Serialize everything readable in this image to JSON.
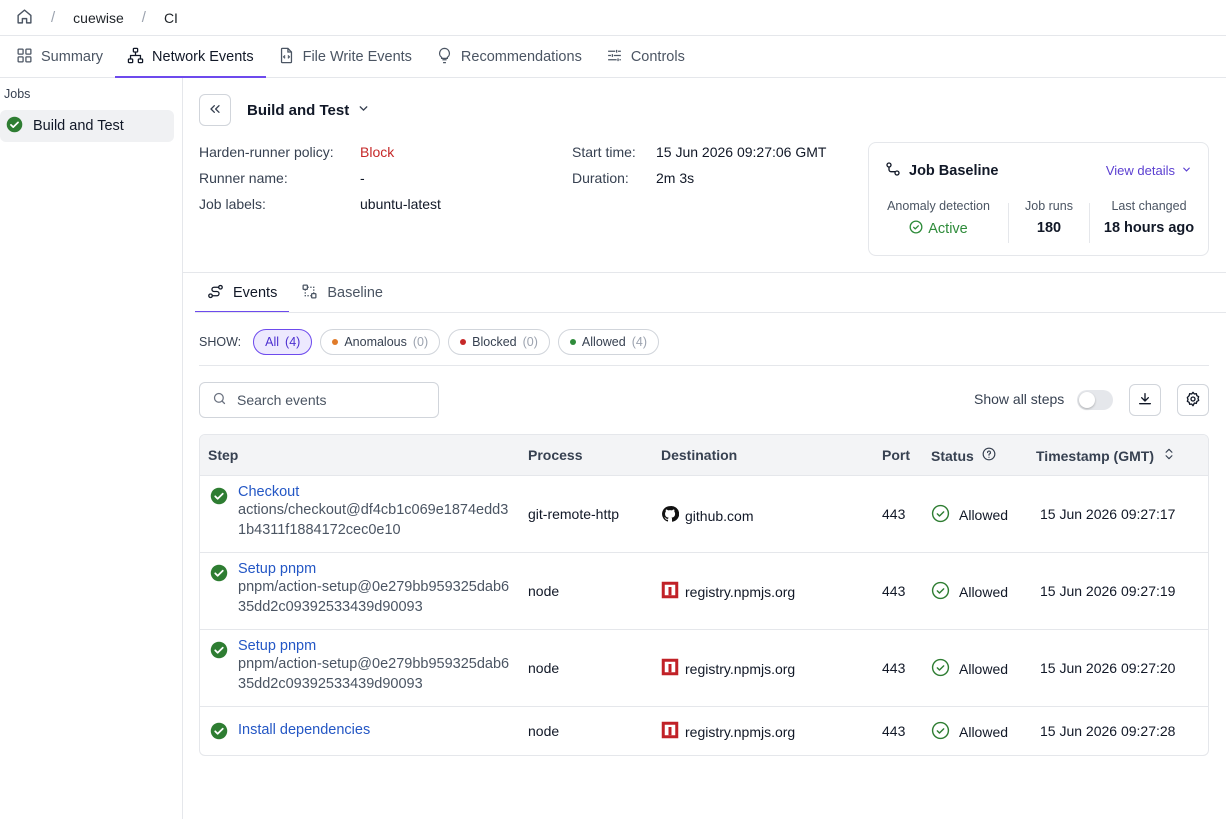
{
  "breadcrumb": {
    "org": "cuewise",
    "repo": "CI"
  },
  "tabs": [
    {
      "label": "Summary",
      "icon": "grid-icon"
    },
    {
      "label": "Network Events",
      "icon": "network-icon"
    },
    {
      "label": "File Write Events",
      "icon": "file-code-icon"
    },
    {
      "label": "Recommendations",
      "icon": "lightbulb-icon"
    },
    {
      "label": "Controls",
      "icon": "sliders-icon"
    }
  ],
  "sidebar": {
    "title": "Jobs",
    "items": [
      {
        "label": "Build and Test"
      }
    ]
  },
  "job": {
    "title": "Build and Test",
    "policy_label": "Harden-runner policy:",
    "policy_value": "Block",
    "runner_label": "Runner name:",
    "runner_value": "-",
    "labels_label": "Job labels:",
    "labels_value": "ubuntu-latest",
    "start_label": "Start time:",
    "start_value": "15 Jun 2026 09:27:06 GMT",
    "duration_label": "Duration:",
    "duration_value": "2m 3s"
  },
  "baseline": {
    "title": "Job Baseline",
    "view_details": "View details",
    "anomaly_label": "Anomaly detection",
    "anomaly_value": "Active",
    "runs_label": "Job runs",
    "runs_value": "180",
    "changed_label": "Last changed",
    "changed_value": "18 hours ago"
  },
  "subtabs": [
    {
      "label": "Events"
    },
    {
      "label": "Baseline"
    }
  ],
  "filters": {
    "show_label": "SHOW:",
    "chips": [
      {
        "label": "All",
        "count": "(4)"
      },
      {
        "label": "Anomalous",
        "count": "(0)",
        "color": "#e07b2a"
      },
      {
        "label": "Blocked",
        "count": "(0)",
        "color": "#c62828"
      },
      {
        "label": "Allowed",
        "count": "(4)",
        "color": "#2e8b3a"
      }
    ]
  },
  "toolbar": {
    "search_placeholder": "Search events",
    "show_all_steps": "Show all steps"
  },
  "table": {
    "headers": {
      "step": "Step",
      "process": "Process",
      "destination": "Destination",
      "port": "Port",
      "status": "Status",
      "timestamp": "Timestamp (GMT)"
    },
    "rows": [
      {
        "step": "Checkout",
        "action": "actions/checkout@df4cb1c069e1874edd31b4311f1884172cec0e10",
        "process": "git-remote-http",
        "destination": "github.com",
        "dest_icon": "github-icon",
        "port": "443",
        "status": "Allowed",
        "timestamp": "15 Jun 2026 09:27:17"
      },
      {
        "step": "Setup pnpm",
        "action": "pnpm/action-setup@0e279bb959325dab635dd2c09392533439d90093",
        "process": "node",
        "destination": "registry.npmjs.org",
        "dest_icon": "npm-icon",
        "port": "443",
        "status": "Allowed",
        "timestamp": "15 Jun 2026 09:27:19"
      },
      {
        "step": "Setup pnpm",
        "action": "pnpm/action-setup@0e279bb959325dab635dd2c09392533439d90093",
        "process": "node",
        "destination": "registry.npmjs.org",
        "dest_icon": "npm-icon",
        "port": "443",
        "status": "Allowed",
        "timestamp": "15 Jun 2026 09:27:20"
      },
      {
        "step": "Install dependencies",
        "action": "",
        "process": "node",
        "destination": "registry.npmjs.org",
        "dest_icon": "npm-icon",
        "port": "443",
        "status": "Allowed",
        "timestamp": "15 Jun 2026 09:27:28"
      }
    ]
  },
  "colors": {
    "accent": "#6d4aed",
    "link": "#2457c5",
    "success": "#2e8b3a",
    "danger": "#c62828"
  }
}
